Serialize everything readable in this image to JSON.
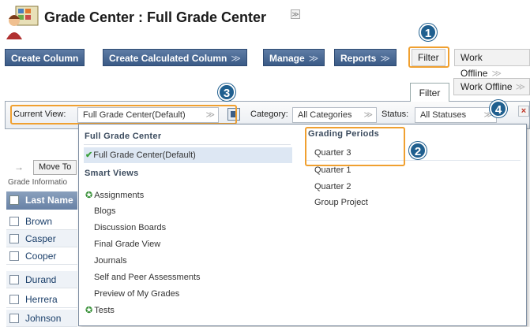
{
  "page": {
    "title": "Grade Center : Full Grade Center"
  },
  "toolbar": {
    "create_column": "Create Column",
    "create_calculated_column": "Create Calculated Column",
    "manage": "Manage",
    "reports": "Reports",
    "filter": "Filter",
    "work_offline": "Work Offline",
    "chevron": "≫"
  },
  "callouts": {
    "one": "1",
    "two": "2",
    "three": "3",
    "four": "4"
  },
  "filter_tabs": {
    "filter": "Filter",
    "work_offline": "Work Offline"
  },
  "filter_bar": {
    "current_view_label": "Current View:",
    "current_view_value": "Full Grade Center(Default)",
    "category_label": "Category:",
    "category_value": "All Categories",
    "status_label": "Status:",
    "status_value": "All Statuses",
    "close_glyph": "×"
  },
  "grade_table": {
    "move_to": "Move To",
    "grade_information": "Grade Informatio",
    "header_last_name": "Last Name",
    "rows": [
      "Brown",
      "Casper",
      "Cooper",
      "Durand",
      "Herrera",
      "Johnson"
    ]
  },
  "dropdown": {
    "full_grade_center_heading": "Full Grade Center",
    "full_grade_center_default": "Full Grade Center(Default)",
    "smart_views_heading": "Smart Views",
    "smart_views": [
      "Assignments",
      "Blogs",
      "Discussion Boards",
      "Final Grade View",
      "Journals",
      "Self and Peer Assessments",
      "Preview of My Grades",
      "Tests"
    ],
    "grading_periods_heading": "Grading Periods",
    "grading_periods": [
      "Quarter 3",
      "Quarter 1",
      "Quarter 2",
      "Group Project"
    ]
  },
  "colors": {
    "accent": "#3a5a86",
    "highlight": "#f0a030",
    "callout": "#1f5f8f",
    "check_green": "#3aa03a"
  }
}
